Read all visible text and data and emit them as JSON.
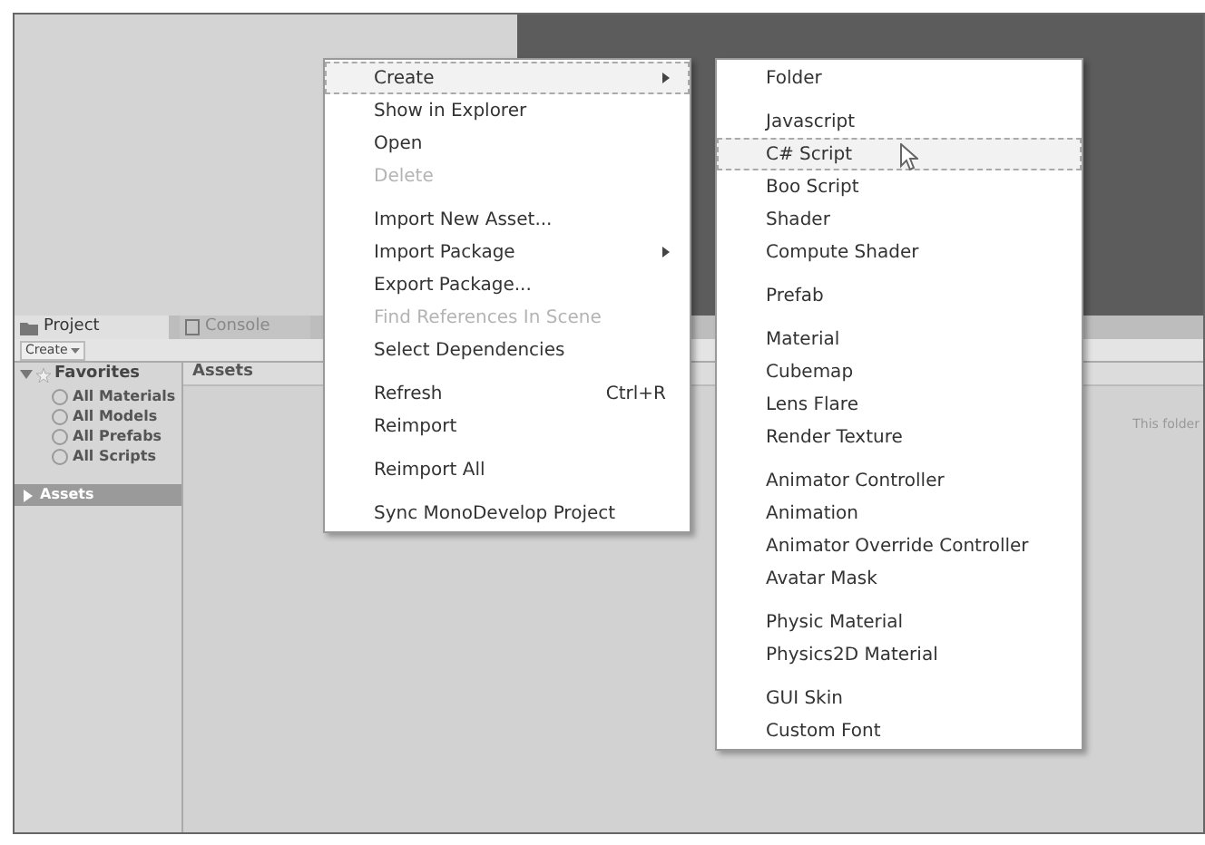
{
  "project_window": {
    "tabs": [
      {
        "label": "Project",
        "kind": "folder",
        "selected": true
      },
      {
        "label": "Console",
        "kind": "console",
        "selected": false
      }
    ],
    "create_button": "Create",
    "favorites": {
      "label": "Favorites",
      "expanded": true,
      "children": [
        {
          "label": "All Materials"
        },
        {
          "label": "All Models"
        },
        {
          "label": "All Prefabs"
        },
        {
          "label": "All Scripts"
        }
      ]
    },
    "assets_tree": {
      "label": "Assets",
      "expanded": false,
      "selected": true
    },
    "breadcrumb": "Assets",
    "empty_message": "This folder"
  },
  "context_menu": {
    "groups": [
      [
        {
          "label": "Create",
          "submenu": true,
          "selected": true,
          "disabled": false
        },
        {
          "label": "Show in Explorer",
          "submenu": false,
          "selected": false,
          "disabled": false
        },
        {
          "label": "Open",
          "submenu": false,
          "selected": false,
          "disabled": false
        },
        {
          "label": "Delete",
          "submenu": false,
          "selected": false,
          "disabled": true
        }
      ],
      [
        {
          "label": "Import New Asset...",
          "submenu": false,
          "selected": false,
          "disabled": false
        },
        {
          "label": "Import Package",
          "submenu": true,
          "selected": false,
          "disabled": false
        },
        {
          "label": "Export Package...",
          "submenu": false,
          "selected": false,
          "disabled": false
        },
        {
          "label": "Find References In Scene",
          "submenu": false,
          "selected": false,
          "disabled": true
        },
        {
          "label": "Select Dependencies",
          "submenu": false,
          "selected": false,
          "disabled": false
        }
      ],
      [
        {
          "label": "Refresh",
          "shortcut": "Ctrl+R",
          "submenu": false,
          "selected": false,
          "disabled": false
        },
        {
          "label": "Reimport",
          "submenu": false,
          "selected": false,
          "disabled": false
        }
      ],
      [
        {
          "label": "Reimport All",
          "submenu": false,
          "selected": false,
          "disabled": false
        }
      ],
      [
        {
          "label": "Sync MonoDevelop Project",
          "submenu": false,
          "selected": false,
          "disabled": false
        }
      ]
    ]
  },
  "create_submenu": {
    "groups": [
      [
        {
          "label": "Folder",
          "selected": false
        }
      ],
      [
        {
          "label": "Javascript",
          "selected": false
        },
        {
          "label": "C# Script",
          "selected": true
        },
        {
          "label": "Boo Script",
          "selected": false
        },
        {
          "label": "Shader",
          "selected": false
        },
        {
          "label": "Compute Shader",
          "selected": false
        }
      ],
      [
        {
          "label": "Prefab",
          "selected": false
        }
      ],
      [
        {
          "label": "Material",
          "selected": false
        },
        {
          "label": "Cubemap",
          "selected": false
        },
        {
          "label": "Lens Flare",
          "selected": false
        },
        {
          "label": "Render Texture",
          "selected": false
        }
      ],
      [
        {
          "label": "Animator Controller",
          "selected": false
        },
        {
          "label": "Animation",
          "selected": false
        },
        {
          "label": "Animator Override Controller",
          "selected": false
        },
        {
          "label": "Avatar Mask",
          "selected": false
        }
      ],
      [
        {
          "label": "Physic Material",
          "selected": false
        },
        {
          "label": "Physics2D Material",
          "selected": false
        }
      ],
      [
        {
          "label": "GUI Skin",
          "selected": false
        },
        {
          "label": "Custom Font",
          "selected": false
        }
      ]
    ]
  }
}
